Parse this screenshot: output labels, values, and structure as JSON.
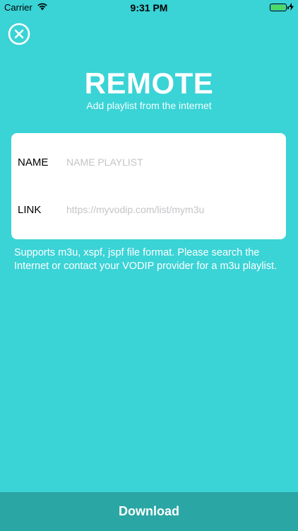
{
  "status_bar": {
    "carrier": "Carrier",
    "time": "9:31 PM",
    "battery_level": 1.0,
    "battery_color": "#4cd964"
  },
  "header": {
    "close_icon": "close-circle-icon",
    "title": "REMOTE",
    "subtitle": "Add playlist from the internet"
  },
  "form": {
    "name_label": "NAME",
    "name_placeholder": "NAME PLAYLIST",
    "name_value": "",
    "link_label": "LINK",
    "link_placeholder": "https://myvodip.com/list/mym3u",
    "link_value": ""
  },
  "info": {
    "text": "Supports m3u, xspf, jspf file format. Please search the Internet or contact your VODIP provider for a m3u playlist."
  },
  "footer": {
    "download_label": "Download"
  },
  "colors": {
    "background": "#3ad3d6",
    "download_bar": "#2aa6a4"
  }
}
